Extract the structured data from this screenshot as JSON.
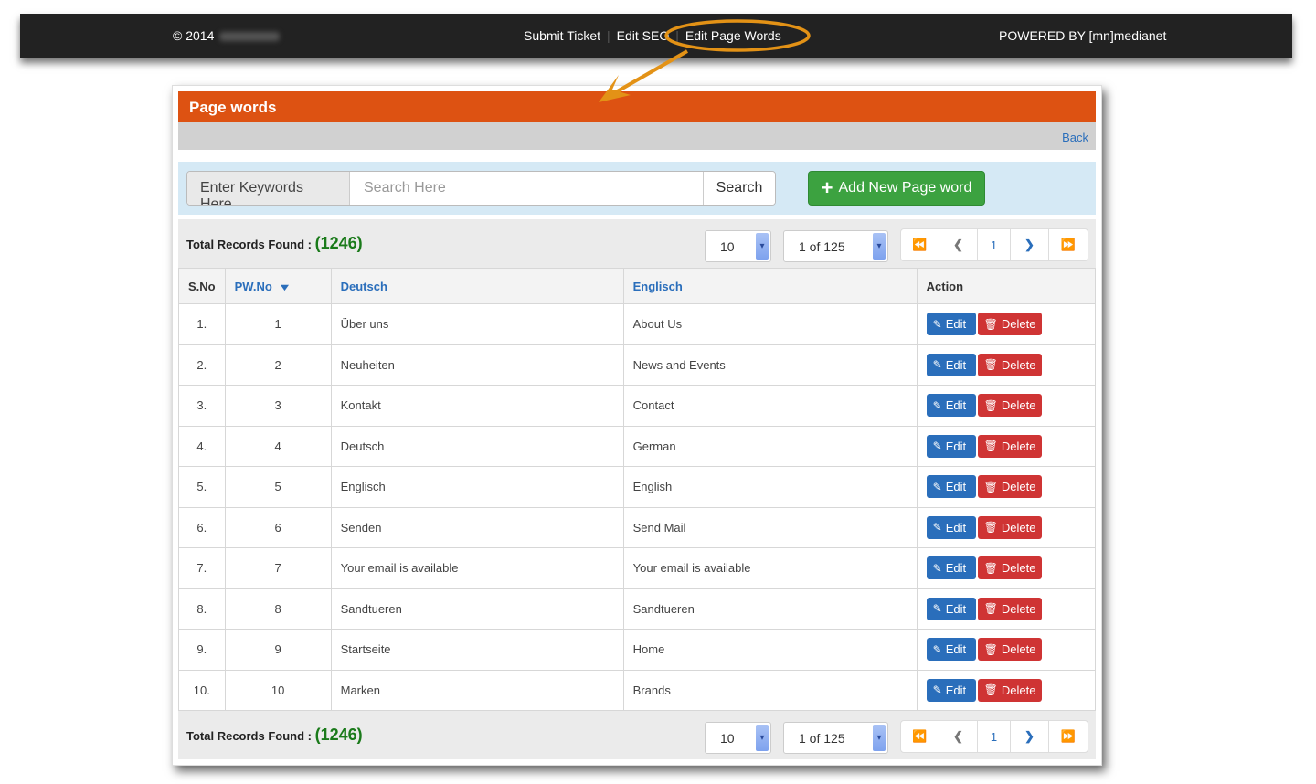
{
  "topbar": {
    "copyright": "© 2014",
    "links": [
      "Submit Ticket",
      "Edit SEO",
      "Edit Page Words"
    ],
    "powered_by": "POWERED BY [mn]medianet"
  },
  "annotation": {
    "color": "#e39216",
    "highlight_target": "Edit Page Words"
  },
  "panel": {
    "title": "Page words",
    "back_label": "Back",
    "header_color": "#dd5212"
  },
  "search": {
    "addon_label": "Enter Keywords Here",
    "placeholder": "Search Here",
    "value": "",
    "button_label": "Search",
    "add_button_label": "Add New Page word"
  },
  "records": {
    "label": "Total Records Found :",
    "count": "(1246)",
    "page_size": "10",
    "page_select": "1 of 125",
    "current_page": "1"
  },
  "table": {
    "headers": [
      "S.No",
      "PW.No",
      "Deutsch",
      "Englisch",
      "Action"
    ],
    "edit_label": "Edit",
    "delete_label": "Delete",
    "rows": [
      {
        "sno": "1.",
        "pwno": "1",
        "deutsch": "Über uns",
        "englisch": "About Us"
      },
      {
        "sno": "2.",
        "pwno": "2",
        "deutsch": "Neuheiten",
        "englisch": "News and Events"
      },
      {
        "sno": "3.",
        "pwno": "3",
        "deutsch": "Kontakt",
        "englisch": "Contact"
      },
      {
        "sno": "4.",
        "pwno": "4",
        "deutsch": "Deutsch",
        "englisch": "German"
      },
      {
        "sno": "5.",
        "pwno": "5",
        "deutsch": "Englisch",
        "englisch": "English"
      },
      {
        "sno": "6.",
        "pwno": "6",
        "deutsch": "Senden",
        "englisch": "Send Mail"
      },
      {
        "sno": "7.",
        "pwno": "7",
        "deutsch": "Your email is available",
        "englisch": "Your email is available"
      },
      {
        "sno": "8.",
        "pwno": "8",
        "deutsch": "Sandtueren",
        "englisch": "Sandtueren"
      },
      {
        "sno": "9.",
        "pwno": "9",
        "deutsch": "Startseite",
        "englisch": "Home"
      },
      {
        "sno": "10.",
        "pwno": "10",
        "deutsch": "Marken",
        "englisch": "Brands"
      }
    ]
  }
}
